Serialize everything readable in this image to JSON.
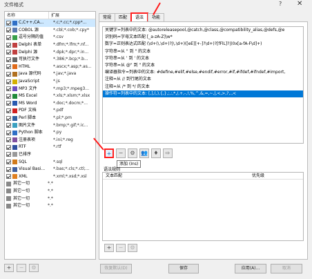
{
  "window": {
    "title": "文件格式",
    "help_glyph": "?",
    "close_glyph": "✕"
  },
  "left_list": {
    "col_name": "名称",
    "col_ext": "扩展",
    "items": [
      {
        "name": "C,C++,CA...",
        "ext": "*.c;*.cc;*.cpp*...",
        "checked": true,
        "selected": true,
        "icon": "c-file-icon"
      },
      {
        "name": "COBOL 源",
        "ext": "*.cbl;*.cob;*.cpy*",
        "checked": true,
        "icon": "cobol-file-icon"
      },
      {
        "name": "逗号分隔的值",
        "ext": "*.csv",
        "checked": true,
        "icon": "csv-file-icon"
      },
      {
        "name": "Delphi 表单",
        "ext": "*.dfm;*.lfm;*.nf...",
        "checked": true,
        "icon": "delphi-form-icon"
      },
      {
        "name": "Delphi 源",
        "ext": "*.dpk;*.dpr;*.in...",
        "checked": true,
        "icon": "delphi-file-icon"
      },
      {
        "name": "可执行文件",
        "ext": "*.386;*.bcp;*.b...",
        "checked": true,
        "icon": "exe-file-icon"
      },
      {
        "name": "HTML",
        "ext": "*.ascx;*.asp;*.as...",
        "checked": true,
        "icon": "html-file-icon"
      },
      {
        "name": "Java 源代码",
        "ext": "*.jav;*.java",
        "checked": true,
        "icon": "java-file-icon"
      },
      {
        "name": "JavaScript",
        "ext": "*.js",
        "checked": true,
        "icon": "js-file-icon"
      },
      {
        "name": "MP3 文件",
        "ext": "*.mp3;*.mpeg3...",
        "checked": true,
        "icon": "mp3-file-icon"
      },
      {
        "name": "MS Excel",
        "ext": "*.xls;*.xlsm;*.xlsx",
        "checked": true,
        "icon": "excel-file-icon"
      },
      {
        "name": "MS Word",
        "ext": "*.doc;*.docm;*...",
        "checked": true,
        "icon": "word-file-icon"
      },
      {
        "name": "PDF 文档",
        "ext": "*.pdf",
        "checked": true,
        "icon": "pdf-file-icon"
      },
      {
        "name": "Perl 脚本",
        "ext": "*.pl;*.pm",
        "checked": true,
        "icon": "perl-file-icon"
      },
      {
        "name": "图片文件",
        "ext": "*.bmp;*.gif;*.ic...",
        "checked": true,
        "icon": "image-file-icon"
      },
      {
        "name": "Python 脚本",
        "ext": "*.py",
        "checked": true,
        "icon": "python-file-icon"
      },
      {
        "name": "注册表项",
        "ext": "*.ini;*.reg",
        "checked": true,
        "icon": "registry-file-icon"
      },
      {
        "name": "RTF",
        "ext": "*.rtf",
        "checked": true,
        "icon": "rtf-file-icon"
      },
      {
        "name": "已排序",
        "ext": "",
        "checked": true,
        "icon": "sorted-icon"
      },
      {
        "name": "SQL",
        "ext": "*.sql",
        "checked": true,
        "icon": "sql-file-icon"
      },
      {
        "name": "Visual Basi...",
        "ext": "*.bas;*.cls;*.ctl;...",
        "checked": true,
        "icon": "vb-file-icon"
      },
      {
        "name": "XML",
        "ext": "*.xml;*.xsd;*.xsl",
        "checked": true,
        "icon": "xml-file-icon"
      },
      {
        "name": "其它一切",
        "ext": "*.*",
        "checked": false,
        "icon": "other-file-icon"
      },
      {
        "name": "其它一切",
        "ext": "*.*",
        "checked": false,
        "icon": "other-file-icon"
      },
      {
        "name": "其它一切",
        "ext": "*.*",
        "checked": false,
        "icon": "other-file-icon"
      },
      {
        "name": "其它一切",
        "ext": "*.*",
        "checked": false,
        "icon": "other-file-icon"
      }
    ],
    "buttons": [
      "+",
      "−",
      "⚙"
    ]
  },
  "tabs": [
    {
      "label": "常规",
      "active": false
    },
    {
      "label": "匹配",
      "active": false
    },
    {
      "label": "语法",
      "active": true
    },
    {
      "label": "功能",
      "active": false
    }
  ],
  "rules": [
    {
      "text": "关键字=列表中的文本: @autoreleasepool,@catch,@class,@compatibility_alias,@defs,@e",
      "selected": false
    },
    {
      "text": "识别码=字母文本匹配 [_a-zA-Z]\\w*",
      "selected": false
    },
    {
      "text": "数字=正则表达式匹配 (\\d+(\\.\\d+)?|\\.\\d+)([eE][+-]?\\d+)?[fFlL]?|(0x[a-fA-F\\d]+)",
      "selected": false
    },
    {
      "text": "字符串=从 \" 到 \" 的文本",
      "selected": false
    },
    {
      "text": "字符串=从 ' 到 ' 的文本",
      "selected": false
    },
    {
      "text": "字符串=从 @\" 到 \" 的文本",
      "selected": false
    },
    {
      "text": "编译器指令=列表中的文本: #define,#elif,#else,#endif,#error,#if,#ifdef,#ifndef,#import,",
      "selected": false
    },
    {
      "text": "注释=从 // 到行尾的文本",
      "selected": false
    },
    {
      "text": "注释=从 /* 到 */ 的文本",
      "selected": false
    },
    {
      "text": "操作符=列表中的文本: [,],(,),{,},;,:,*,/,+,-,!,%,^,&,=,~,|,<,>,?,.,<",
      "selected": true
    }
  ],
  "rule_toolbar": {
    "add": "+",
    "remove": "−",
    "settings": "⚙",
    "users": "👥",
    "marker": "♦",
    "import": "⇨"
  },
  "tooltip": "添加 (Ins)",
  "section_label": "语法规则",
  "grid": {
    "col_text": "文本匹配",
    "col_priority": "优先级"
  },
  "grid_toolbar": [
    "+",
    "−",
    "⚙"
  ],
  "footer": {
    "save_defaults": "恢复默认(D)",
    "default": "默认(D)",
    "save": "保存",
    "apply": "应用(A)...",
    "cancel": "取消"
  },
  "colors": {
    "accent_red": "#ff1a1a",
    "selection_blue": "#0078d7",
    "list_highlight": "#cde8ff"
  }
}
